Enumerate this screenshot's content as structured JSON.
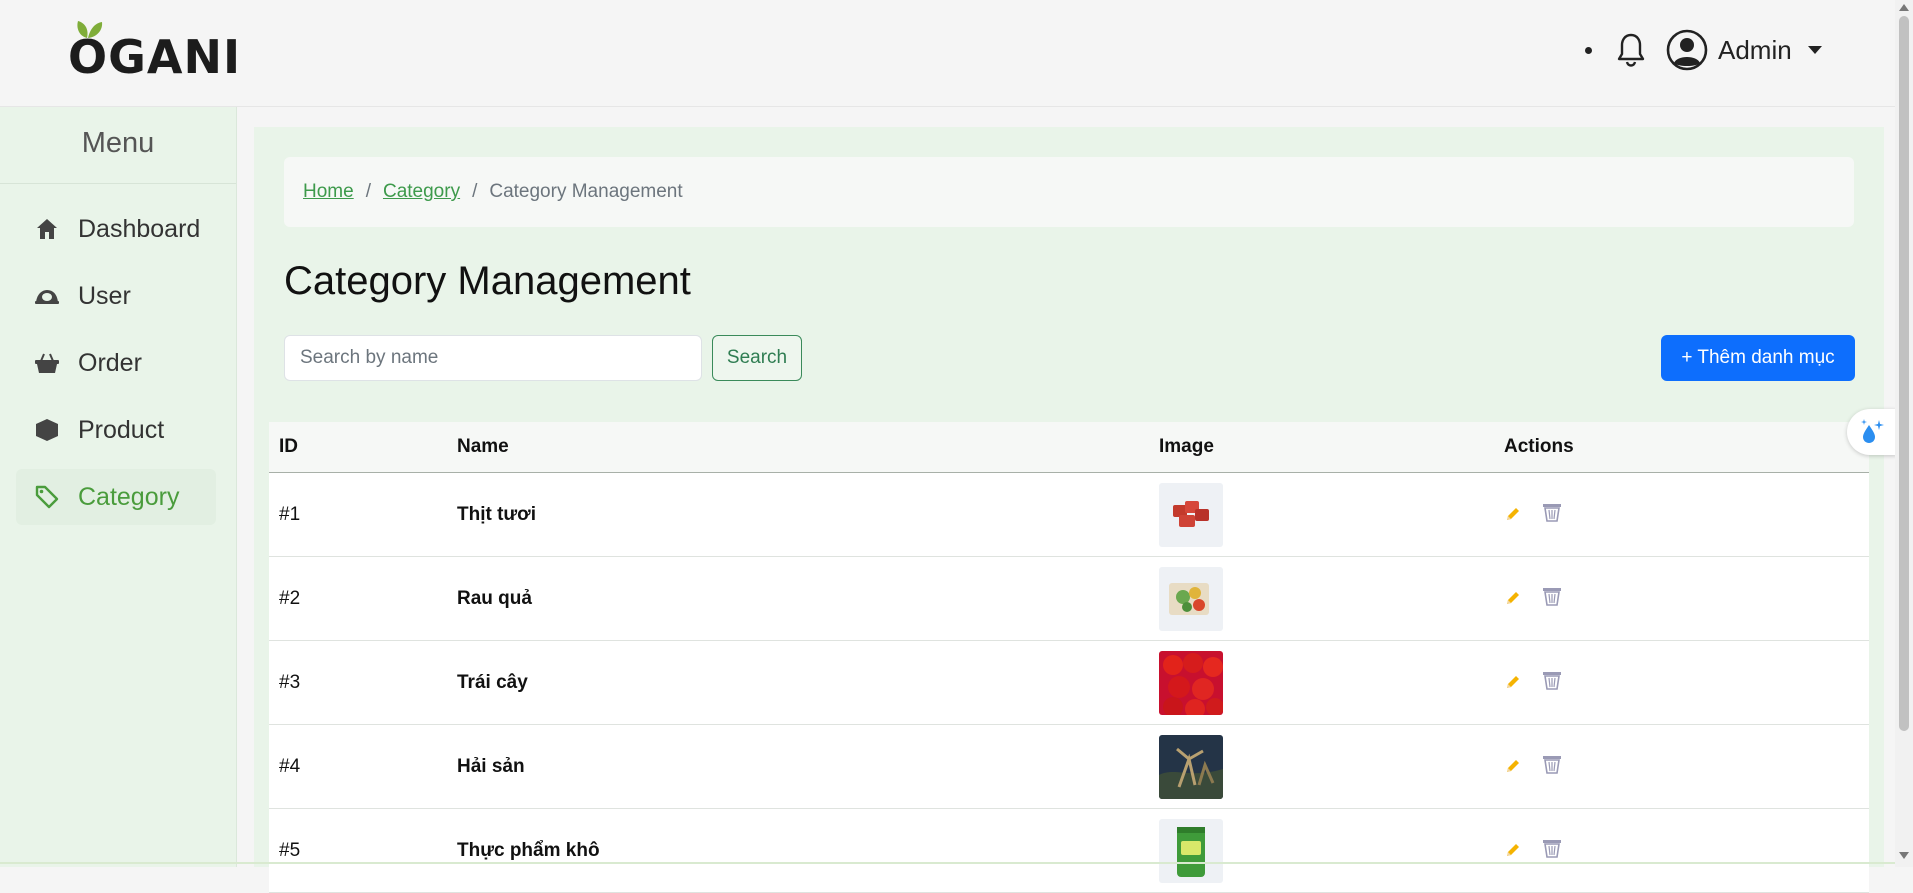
{
  "header": {
    "logo": "OGANI",
    "user_name": "Admin"
  },
  "sidebar": {
    "title": "Menu",
    "items": [
      {
        "label": "Dashboard",
        "icon": "home-icon"
      },
      {
        "label": "User",
        "icon": "user-icon"
      },
      {
        "label": "Order",
        "icon": "basket-icon"
      },
      {
        "label": "Product",
        "icon": "box-icon"
      },
      {
        "label": "Category",
        "icon": "tag-icon",
        "active": true
      }
    ]
  },
  "breadcrumb": {
    "home": "Home",
    "category": "Category",
    "separator": "/",
    "current": "Category Management"
  },
  "page_title": "Category Management",
  "search": {
    "placeholder": "Search by name",
    "value": "",
    "button_label": "Search"
  },
  "add_button_label": "+ Thêm danh mục",
  "table": {
    "headers": {
      "id": "ID",
      "name": "Name",
      "image": "Image",
      "actions": "Actions"
    },
    "rows": [
      {
        "id": "#1",
        "name": "Thịt tươi"
      },
      {
        "id": "#2",
        "name": "Rau quả"
      },
      {
        "id": "#3",
        "name": "Trái cây"
      },
      {
        "id": "#4",
        "name": "Hải sản"
      },
      {
        "id": "#5",
        "name": "Thực phẩm khô"
      }
    ]
  },
  "colors": {
    "accent_green": "#4a9c3c",
    "primary_blue": "#0d6efd",
    "sidebar_bg": "#e9f4e9"
  }
}
